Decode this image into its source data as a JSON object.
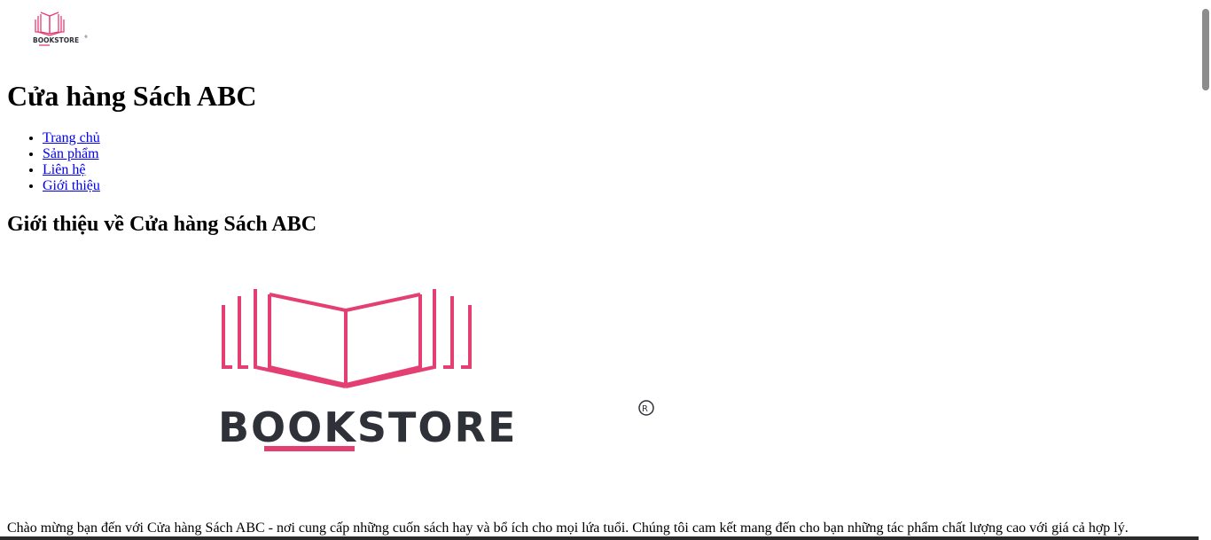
{
  "header": {
    "logo_text": "BOOKSTORE",
    "logo_registered": "®",
    "title": "Cửa hàng Sách ABC"
  },
  "nav": {
    "items": [
      {
        "label": "Trang chủ"
      },
      {
        "label": "Sản phẩm"
      },
      {
        "label": "Liên hệ"
      },
      {
        "label": "Giới thiệu"
      }
    ]
  },
  "about": {
    "heading": "Giới thiệu về Cửa hàng Sách ABC",
    "logo_text": "BOOKSTORE",
    "logo_registered": "®",
    "paragraph": "Chào mừng bạn đến với Cửa hàng Sách ABC - nơi cung cấp những cuốn sách hay và bổ ích cho mọi lứa tuổi. Chúng tôi cam kết mang đến cho bạn những tác phẩm chất lượng cao với giá cả hợp lý."
  },
  "colors": {
    "brand_pink": "#e43f73",
    "brand_dark": "#2f3138",
    "link": "#0000ee"
  }
}
